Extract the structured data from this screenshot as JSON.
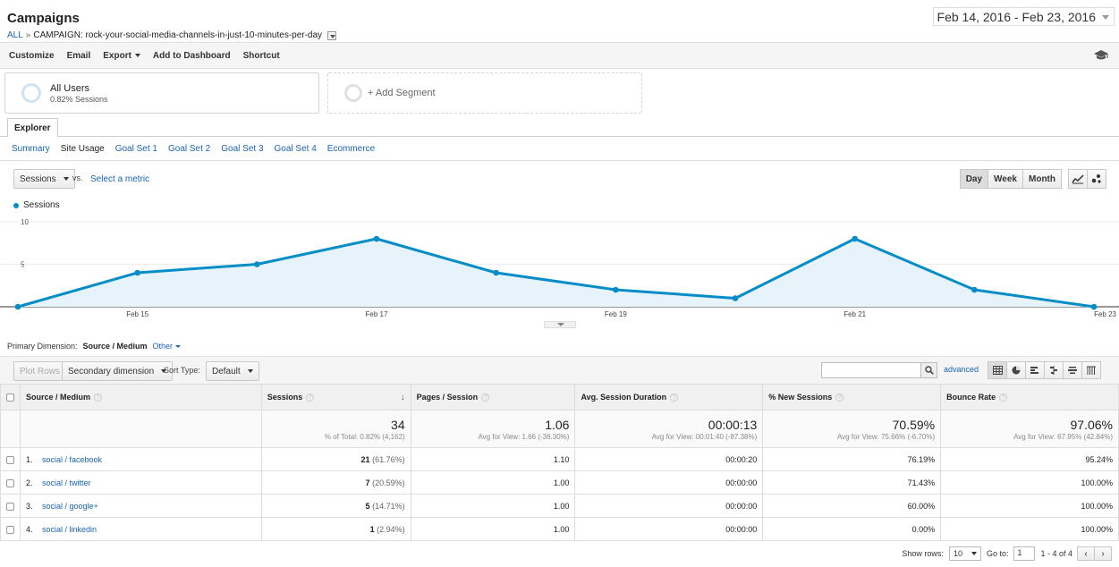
{
  "header": {
    "title": "Campaigns",
    "breadcrumb_all": "ALL",
    "breadcrumb_sep": "»",
    "breadcrumb_campaign": "CAMPAIGN: rock-your-social-media-channels-in-just-10-minutes-per-day",
    "date_range": "Feb 14, 2016 - Feb 23, 2016"
  },
  "toolbar": {
    "customize": "Customize",
    "email": "Email",
    "export": "Export",
    "add_to_dashboard": "Add to Dashboard",
    "shortcut": "Shortcut"
  },
  "segments": {
    "active_name": "All Users",
    "active_sub": "0.82% Sessions",
    "add_label": "+ Add Segment"
  },
  "explorer": {
    "tab": "Explorer",
    "subtabs": [
      "Summary",
      "Site Usage",
      "Goal Set 1",
      "Goal Set 2",
      "Goal Set 3",
      "Goal Set 4",
      "Ecommerce"
    ]
  },
  "metric": {
    "selected": "Sessions",
    "vs": "vs.",
    "select_metric": "Select a metric",
    "day": "Day",
    "week": "Week",
    "month": "Month"
  },
  "chart_data": {
    "type": "area",
    "series": [
      {
        "name": "Sessions",
        "values": [
          0,
          4,
          5,
          8,
          4,
          2,
          1,
          8,
          2,
          0
        ]
      }
    ],
    "x": [
      "Feb 14",
      "Feb 15",
      "Feb 16",
      "Feb 17",
      "Feb 18",
      "Feb 19",
      "Feb 20",
      "Feb 21",
      "Feb 22",
      "Feb 23"
    ],
    "x_tick_labels": [
      "Feb 15",
      "Feb 17",
      "Feb 19",
      "Feb 21",
      "Feb 23"
    ],
    "y_tick_labels": [
      "10",
      "5"
    ],
    "ylim": [
      0,
      10
    ],
    "color": "#058dc7",
    "fill": "#e6f3fa",
    "grid": true,
    "legend": "top-left"
  },
  "dimension": {
    "label": "Primary Dimension:",
    "value": "Source / Medium",
    "other": "Other"
  },
  "table_controls": {
    "plot_rows": "Plot Rows",
    "secondary_dimension": "Secondary dimension",
    "sort_type_label": "Sort Type:",
    "sort_type_value": "Default",
    "advanced": "advanced"
  },
  "table": {
    "headers": [
      "Source / Medium",
      "Sessions",
      "Pages / Session",
      "Avg. Session Duration",
      "% New Sessions",
      "Bounce Rate"
    ],
    "totals": [
      {
        "value": "34",
        "sub": "% of Total: 0.82% (4,162)"
      },
      {
        "value": "1.06",
        "sub": "Avg for View: 1.66 (-36.30%)"
      },
      {
        "value": "00:00:13",
        "sub": "Avg for View: 00:01:40 (-87.38%)"
      },
      {
        "value": "70.59%",
        "sub": "Avg for View: 75.66% (-6.70%)"
      },
      {
        "value": "97.06%",
        "sub": "Avg for View: 67.95% (42.84%)"
      }
    ],
    "rows": [
      {
        "idx": "1.",
        "source": "social / facebook",
        "sessions": "21",
        "sessions_pct": "(61.76%)",
        "pages": "1.10",
        "duration": "00:00:20",
        "new": "76.19%",
        "bounce": "95.24%"
      },
      {
        "idx": "2.",
        "source": "social / twitter",
        "sessions": "7",
        "sessions_pct": "(20.59%)",
        "pages": "1.00",
        "duration": "00:00:00",
        "new": "71.43%",
        "bounce": "100.00%"
      },
      {
        "idx": "3.",
        "source": "social / google+",
        "sessions": "5",
        "sessions_pct": "(14.71%)",
        "pages": "1.00",
        "duration": "00:00:00",
        "new": "60.00%",
        "bounce": "100.00%"
      },
      {
        "idx": "4.",
        "source": "social / linkedin",
        "sessions": "1",
        "sessions_pct": "(2.94%)",
        "pages": "1.00",
        "duration": "00:00:00",
        "new": "0.00%",
        "bounce": "100.00%"
      }
    ]
  },
  "pager": {
    "show_rows_label": "Show rows:",
    "show_rows_value": "10",
    "goto_label": "Go to:",
    "goto_value": "1",
    "range": "1 - 4 of 4",
    "prev": "‹",
    "next": "›"
  },
  "icons": {
    "graduation": "graduation-cap-icon",
    "search": "search-icon",
    "line_chart": "line-chart-icon",
    "motion_chart": "motion-chart-icon"
  }
}
